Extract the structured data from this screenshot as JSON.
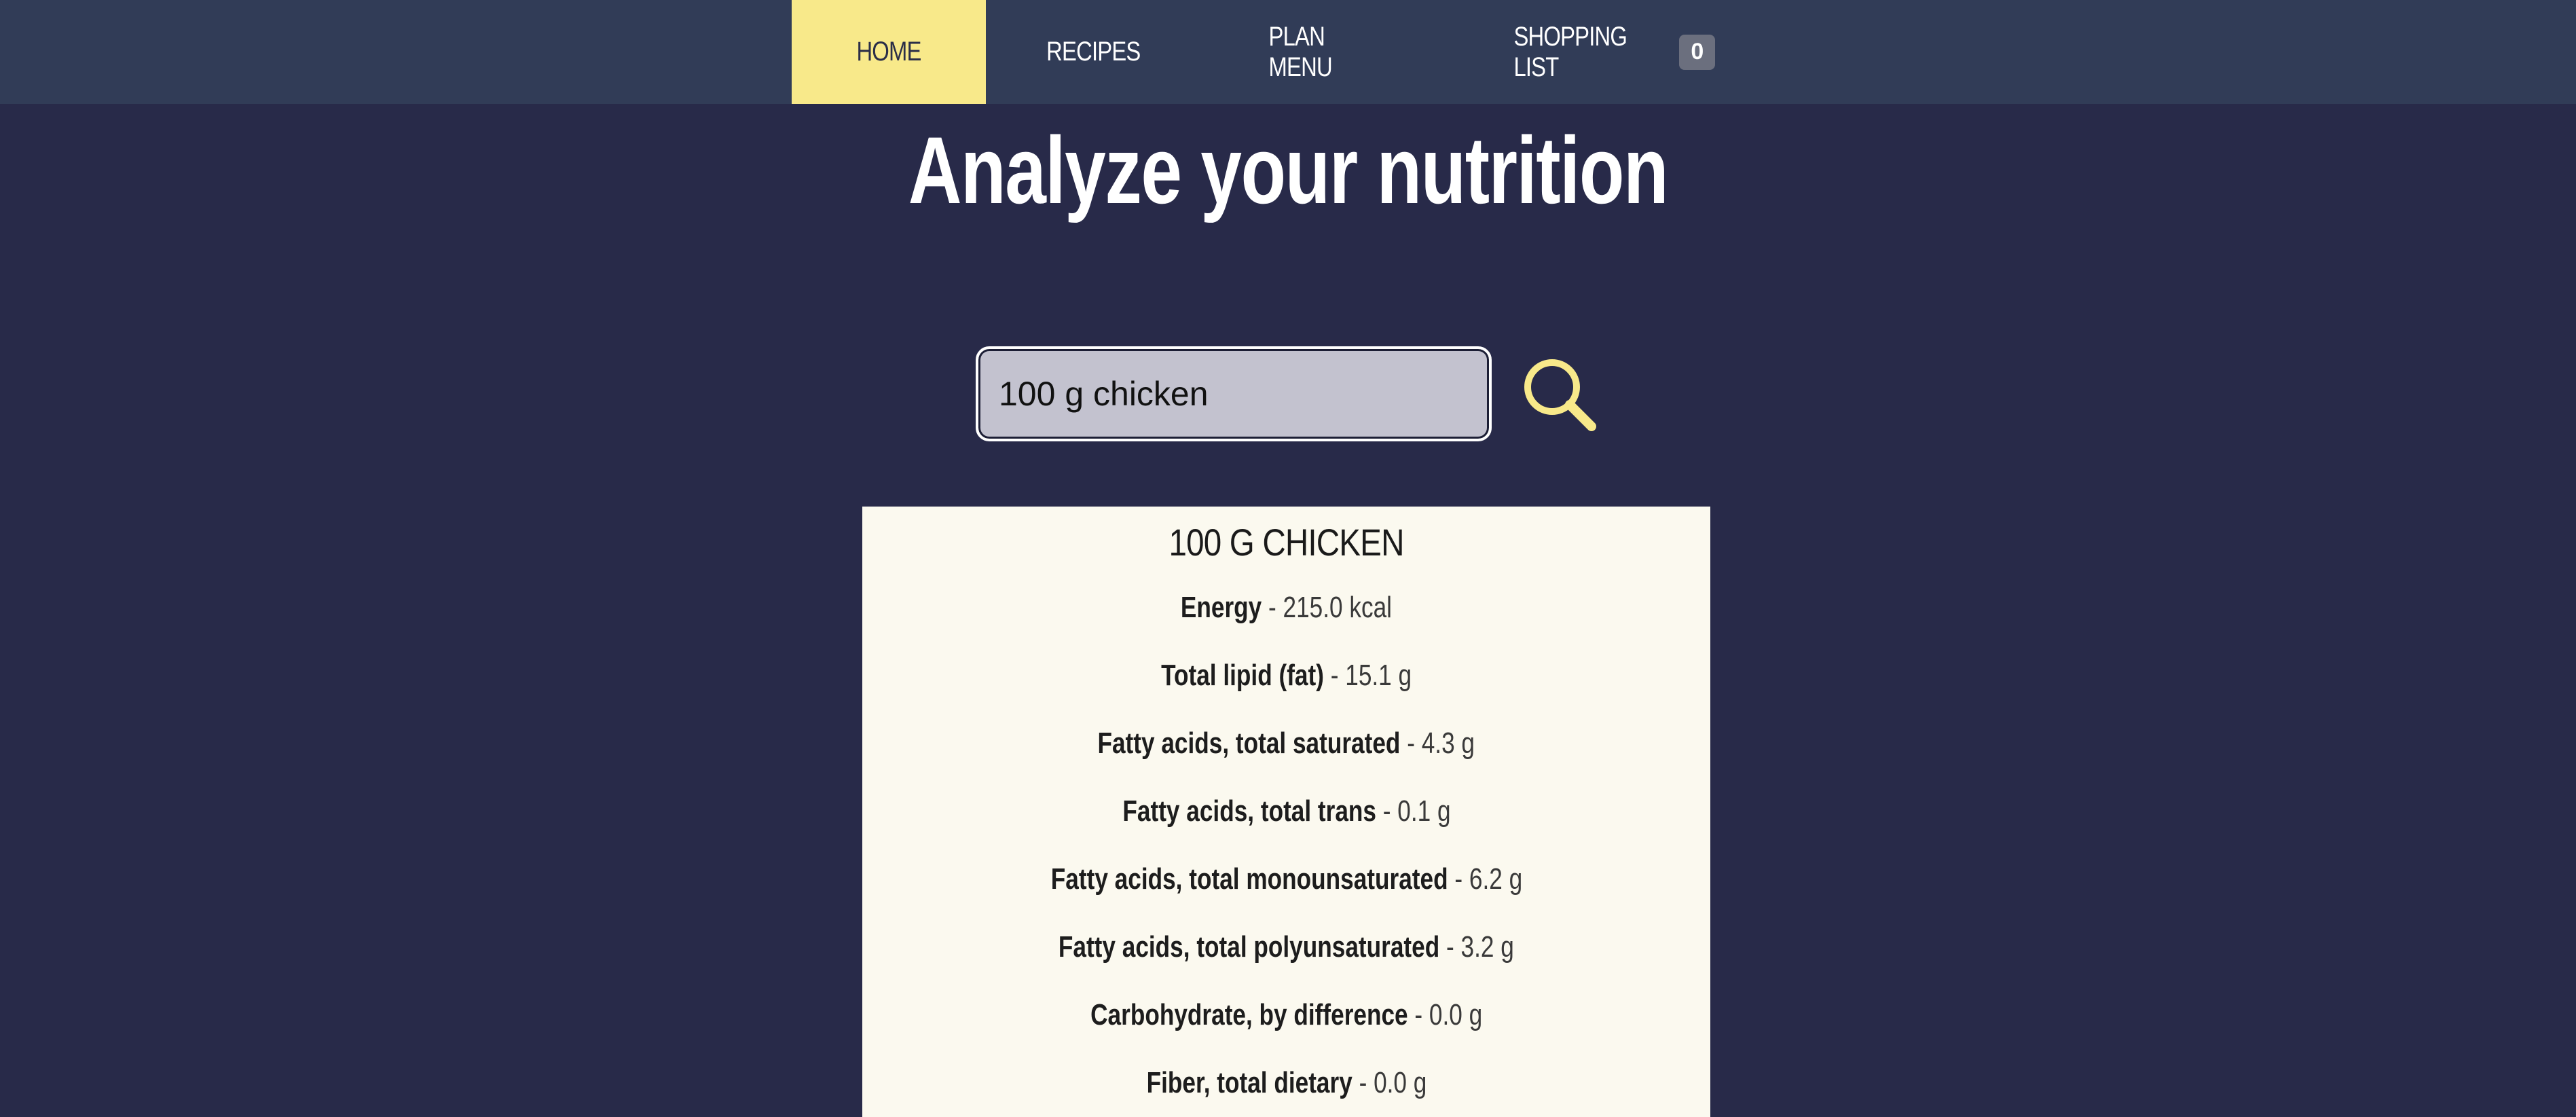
{
  "nav": {
    "items": [
      {
        "label": "HOME"
      },
      {
        "label": "RECIPES"
      },
      {
        "label": "PLAN MENU"
      },
      {
        "label": "SHOPPING LIST"
      }
    ],
    "shopping_count": "0"
  },
  "page": {
    "title": "Analyze your nutrition"
  },
  "search": {
    "value": "100 g chicken",
    "icon": "search-icon"
  },
  "result": {
    "title": "100 G CHICKEN",
    "nutrients": [
      {
        "name": "Energy",
        "value": " - 215.0 kcal"
      },
      {
        "name": "Total lipid (fat)",
        "value": " - 15.1 g"
      },
      {
        "name": "Fatty acids, total saturated",
        "value": " - 4.3 g"
      },
      {
        "name": "Fatty acids, total trans",
        "value": " - 0.1 g"
      },
      {
        "name": "Fatty acids, total monounsaturated",
        "value": " - 6.2 g"
      },
      {
        "name": "Fatty acids, total polyunsaturated",
        "value": " - 3.2 g"
      },
      {
        "name": "Carbohydrate, by difference",
        "value": " - 0.0 g"
      },
      {
        "name": "Fiber, total dietary",
        "value": " - 0.0 g"
      }
    ]
  },
  "colors": {
    "background": "#282a49",
    "navbar": "#313c57",
    "accent": "#f8e98a",
    "card": "#fbf9ef"
  }
}
